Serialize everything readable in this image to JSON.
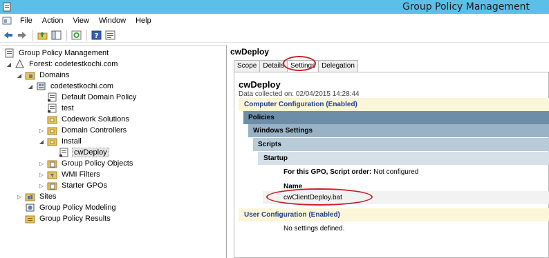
{
  "window": {
    "title": "Group Policy Management"
  },
  "menu": [
    "File",
    "Action",
    "View",
    "Window",
    "Help"
  ],
  "toolbar": {
    "icons": [
      "back-arrow-icon",
      "forward-arrow-icon",
      "folder-up-icon",
      "show-hide-tree-icon",
      "refresh-icon",
      "help-icon",
      "properties-icon"
    ]
  },
  "tree": {
    "root": "Group Policy Management",
    "forest": "Forest: codetestkochi.com",
    "domains": "Domains",
    "domain": "codetestkochi.com",
    "items": [
      "Default Domain Policy",
      "test",
      "Codework Solutions",
      "Domain Controllers",
      "Install",
      "cwDeploy",
      "Group Policy Objects",
      "WMI Filters",
      "Starter GPOs"
    ],
    "sites": "Sites",
    "modeling": "Group Policy Modeling",
    "results": "Group Policy Results"
  },
  "right": {
    "heading": "cwDeploy",
    "tabs": [
      "Scope",
      "Details",
      "Settings",
      "Delegation"
    ],
    "active_tab": "Settings",
    "report": {
      "gpo_name": "cwDeploy",
      "collected": "Data collected on: 02/04/2015 14:28:44",
      "computer_config": "Computer Configuration (Enabled)",
      "policies": "Policies",
      "windows_settings": "Windows Settings",
      "scripts": "Scripts",
      "startup": "Startup",
      "script_order_label": "For this GPO, Script order:",
      "script_order_value": "Not configured",
      "name_label": "Name",
      "script_name": "cwClientDeploy.bat",
      "user_config": "User Configuration (Enabled)",
      "no_settings": "No settings defined."
    }
  },
  "colors": {
    "titlebar": "#5bc0e8",
    "highlight": "#c8202a",
    "section_header_bg": "#fcf6d8",
    "section_header_text": "#1f3f8f"
  }
}
